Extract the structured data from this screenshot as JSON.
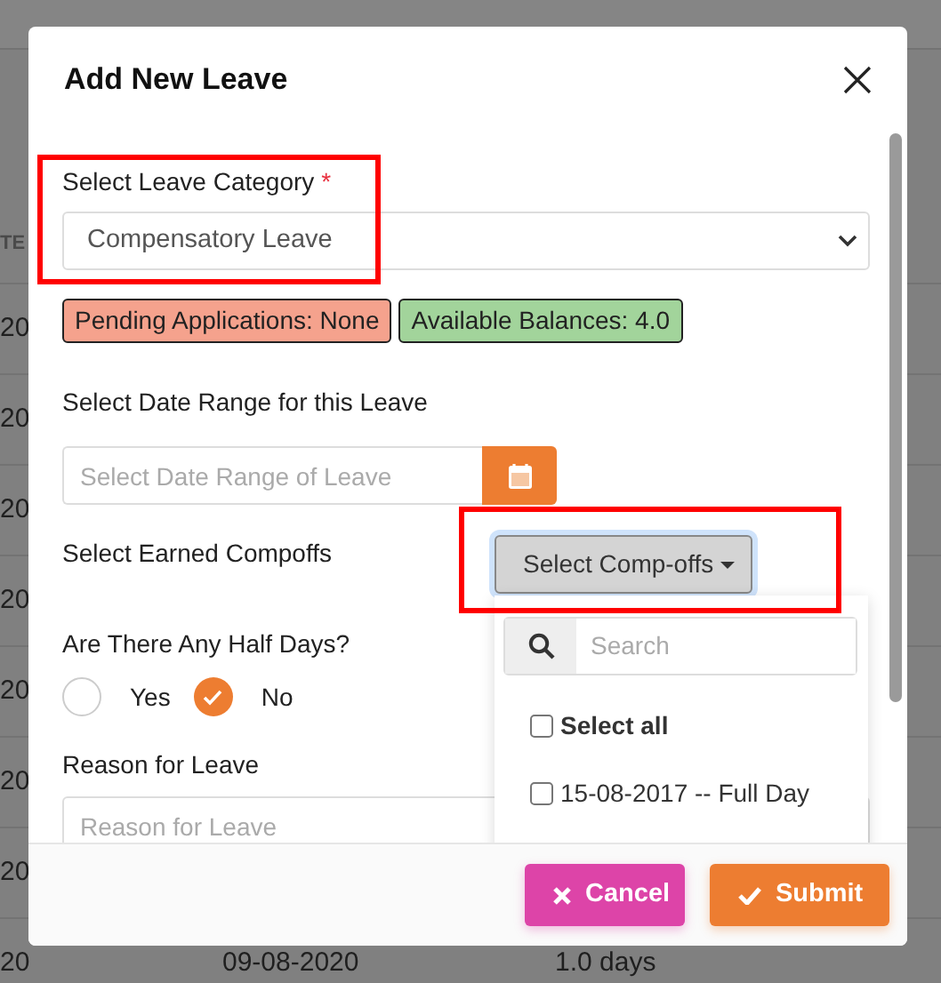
{
  "background": {
    "table_header": "TE",
    "rows": [
      {
        "column_1": "20"
      },
      {
        "column_1": "20"
      },
      {
        "column_1": "20"
      },
      {
        "column_1": "20"
      },
      {
        "column_1": "20"
      },
      {
        "column_1": "20"
      },
      {
        "column_1": "20"
      },
      {
        "column_1": "20",
        "column_2": "09-08-2020",
        "column_3": "1.0 days"
      }
    ]
  },
  "modal": {
    "title": "Add New Leave",
    "category": {
      "label": "Select Leave Category",
      "required_mark": "*",
      "value": "Compensatory Leave",
      "highlighted": true
    },
    "badges": [
      {
        "text": "Pending Applications: None",
        "color": "#f5a28d"
      },
      {
        "text": "Available Balances: 4.0",
        "color": "#a2d49b"
      }
    ],
    "date_range": {
      "label": "Select Date Range for this Leave",
      "placeholder": "Select Date Range of Leave"
    },
    "compoffs": {
      "label": "Select Earned Compoffs",
      "button": "Select Comp-offs",
      "highlighted": true,
      "expanded": true,
      "search_placeholder": "Search",
      "options": [
        {
          "label": "Select all",
          "kind": "select-all",
          "checked": false
        },
        {
          "label": "15-08-2017 -- Full Day",
          "kind": "option",
          "checked": false
        }
      ]
    },
    "half_days": {
      "label": "Are There Any Half Days?",
      "options": [
        {
          "label": "Yes",
          "selected": false
        },
        {
          "label": "No",
          "selected": true
        }
      ]
    },
    "reason": {
      "label": "Reason for Leave",
      "placeholder": "Reason for Leave"
    },
    "buttons": [
      {
        "label": "Cancel",
        "kind": "cancel"
      },
      {
        "label": "Submit",
        "kind": "submit"
      }
    ]
  }
}
